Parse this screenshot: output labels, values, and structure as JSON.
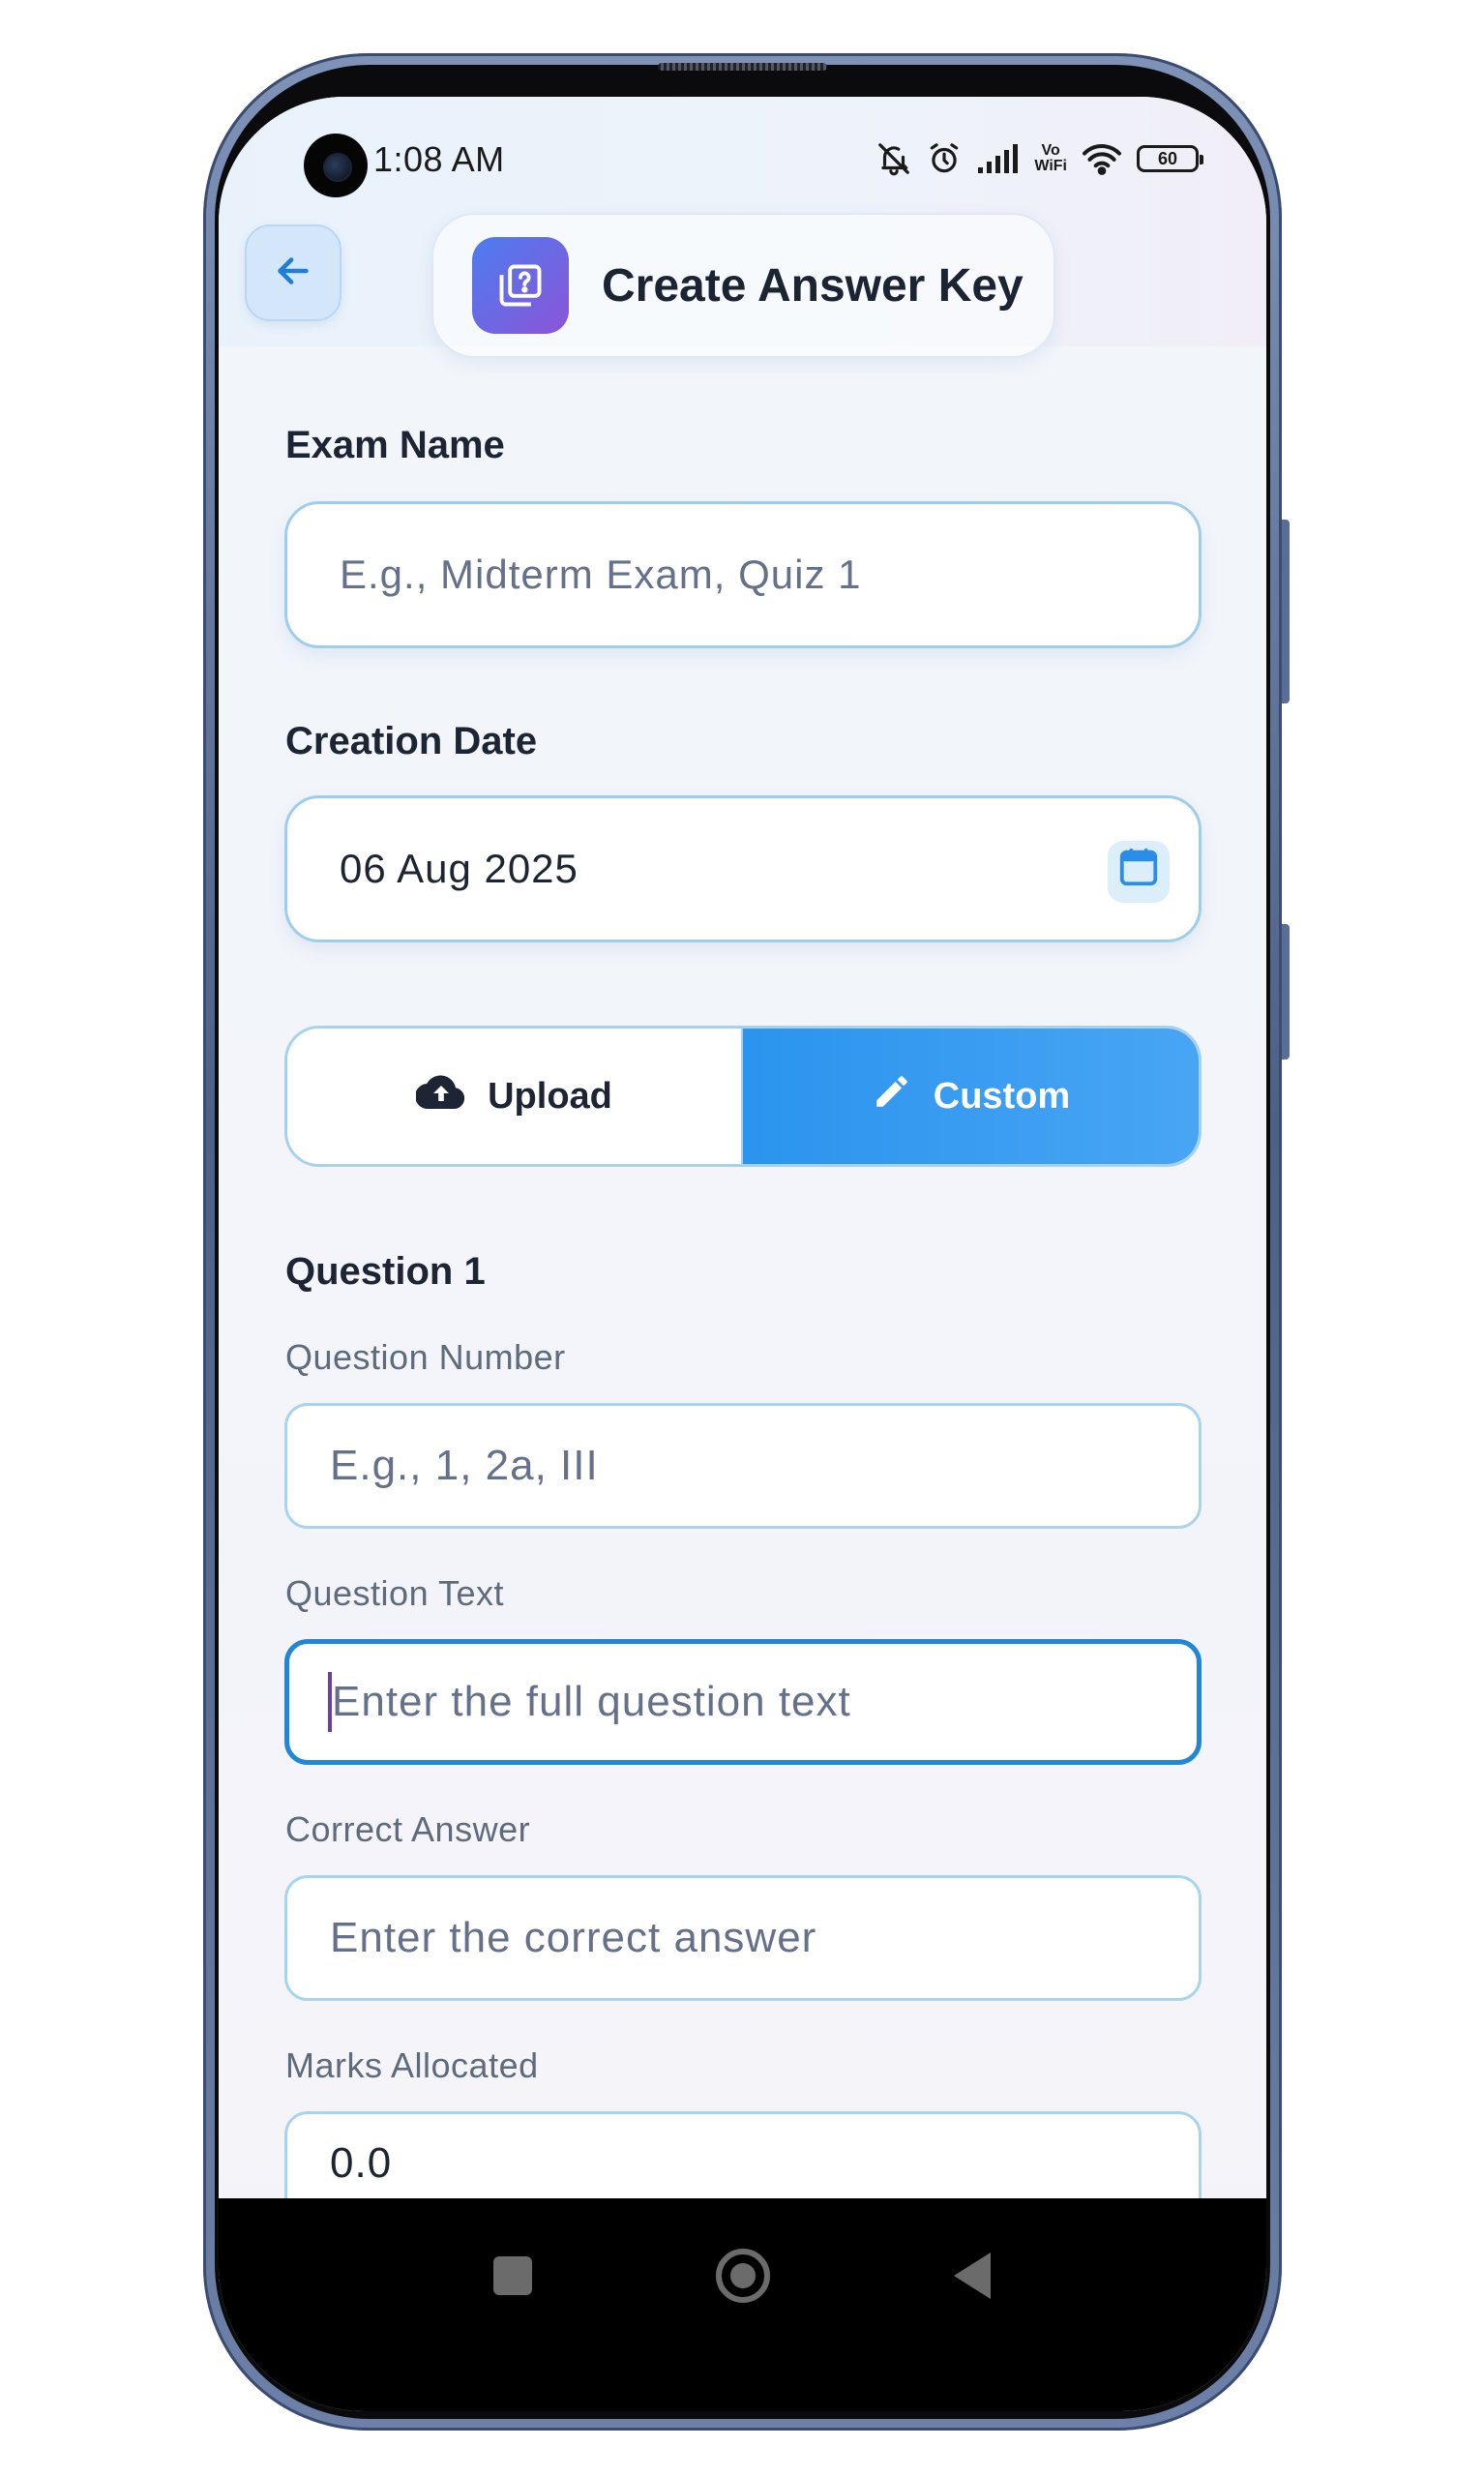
{
  "status_bar": {
    "time": "1:08 AM",
    "network_label_top": "Vo",
    "network_label_bottom": "WiFi",
    "battery_level": "60",
    "icons": [
      "mute-bell-icon",
      "alarm-icon",
      "signal-icon",
      "vowifi-icon",
      "wifi-icon",
      "battery-icon"
    ]
  },
  "header": {
    "back_icon": "arrow-left-icon",
    "title_icon": "quiz-question-icon",
    "title": "Create Answer Key"
  },
  "exam_name": {
    "label": "Exam Name",
    "placeholder": "E.g., Midterm Exam, Quiz 1",
    "value": ""
  },
  "creation_date": {
    "label": "Creation Date",
    "value": "06 Aug 2025",
    "icon": "calendar-icon"
  },
  "mode_toggle": {
    "options": [
      {
        "label": "Upload",
        "icon": "cloud-upload-icon",
        "selected": false
      },
      {
        "label": "Custom",
        "icon": "pencil-icon",
        "selected": true
      }
    ]
  },
  "question": {
    "heading": "Question 1",
    "number": {
      "label": "Question Number",
      "placeholder": "E.g., 1, 2a, III"
    },
    "text": {
      "label": "Question Text",
      "placeholder": "Enter the full question text",
      "focused": true
    },
    "answer": {
      "label": "Correct Answer",
      "placeholder": "Enter the correct answer"
    },
    "marks": {
      "label": "Marks Allocated",
      "value": "0.0"
    }
  },
  "colors": {
    "accent": "#2a94ee",
    "focus_border": "#2185d8",
    "input_border": "#a9d4ee",
    "title_icon_gradient_start": "#4d7cf0",
    "title_icon_gradient_end": "#8b55d6"
  }
}
